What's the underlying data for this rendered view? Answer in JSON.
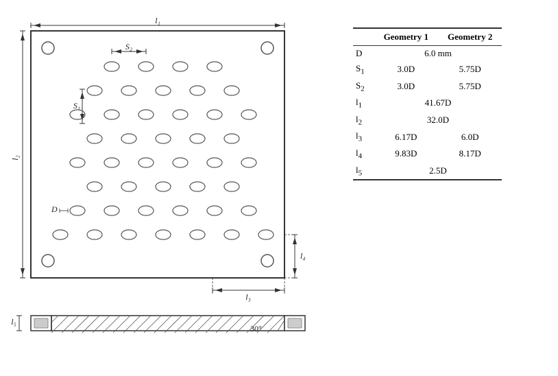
{
  "table": {
    "headers": [
      "",
      "Geometry 1",
      "Geometry 2"
    ],
    "rows": [
      {
        "param": "D",
        "g1": "6.0 mm",
        "g2": "",
        "merged": true
      },
      {
        "param": "S₁",
        "g1": "3.0D",
        "g2": "5.75D",
        "merged": false
      },
      {
        "param": "S₂",
        "g1": "3.0D",
        "g2": "5.75D",
        "merged": false
      },
      {
        "param": "l₁",
        "g1": "41.67D",
        "g2": "",
        "merged": true
      },
      {
        "param": "l₂",
        "g1": "32.0D",
        "g2": "",
        "merged": true
      },
      {
        "param": "l₃",
        "g1": "6.17D",
        "g2": "6.0D",
        "merged": false
      },
      {
        "param": "l₄",
        "g1": "9.83D",
        "g2": "8.17D",
        "merged": false
      },
      {
        "param": "l₅",
        "g1": "2.5D",
        "g2": "",
        "merged": true
      }
    ]
  },
  "diagram": {
    "l1_label": "l₁",
    "l2_label": "l₂",
    "l3_label": "l₃",
    "l4_label": "l₄",
    "l5_label": "l₅",
    "s1_label": "S₁",
    "s2_label": "S₂",
    "d_label": "D",
    "angle_label": "30°"
  }
}
